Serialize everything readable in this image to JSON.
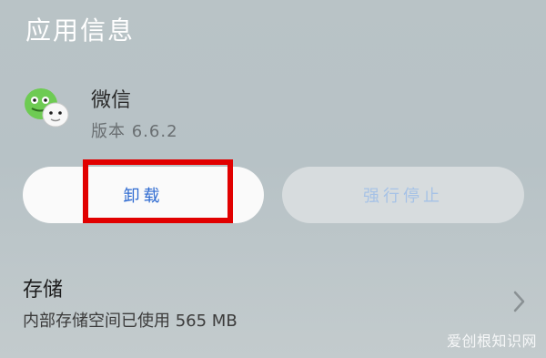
{
  "header": {
    "title": "应用信息"
  },
  "app": {
    "name": "微信",
    "version": "版本 6.6.2",
    "icon": "wechat-app-icon"
  },
  "actions": {
    "uninstall_label": "卸载",
    "force_stop_label": "强行停止",
    "uninstall_highlight_color": "#e10000"
  },
  "storage": {
    "title": "存储",
    "description": "内部存储空间已使用 565 MB"
  },
  "colors": {
    "accent_blue": "#2f6bd1",
    "disabled_blue": "#a6c2e6",
    "background": "#b9c3c6"
  },
  "watermark": {
    "text": "爱创根知识网"
  }
}
